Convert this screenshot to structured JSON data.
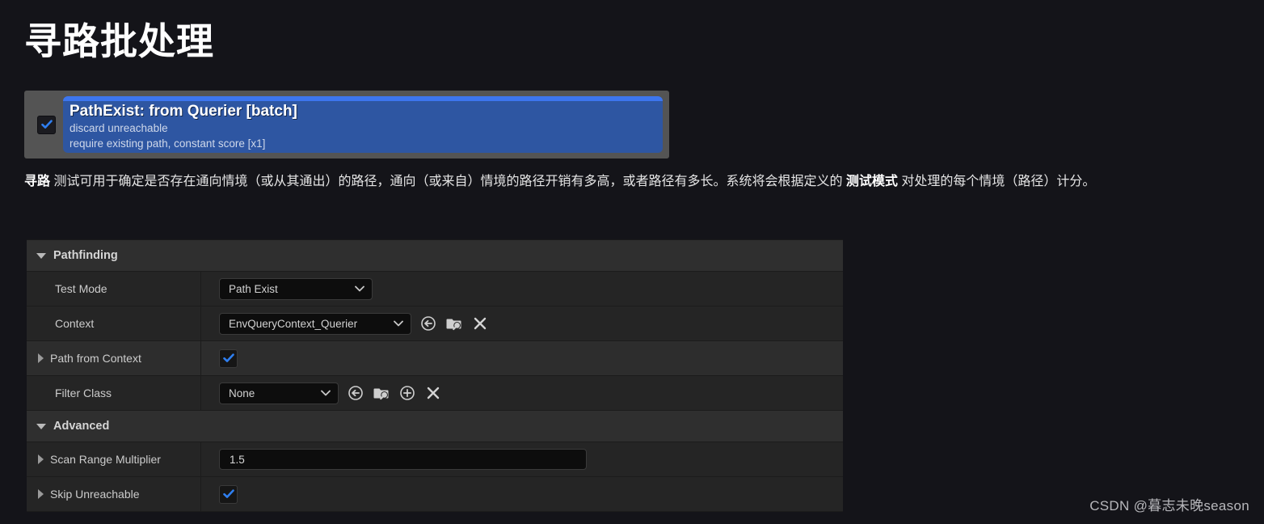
{
  "page": {
    "title": "寻路批处理",
    "background_color": "#141419",
    "watermark": "CSDN @暮志未晚season"
  },
  "node_card": {
    "checkbox_checked": true,
    "title": "PathExist: from Querier [batch]",
    "subtitle_line1": "discard unreachable",
    "subtitle_line2": "require existing path, constant score [x1]",
    "header_accent_color": "#3d76ef",
    "body_color": "#2e56a2",
    "frame_color": "#545454"
  },
  "description": {
    "bold_lead": "寻路",
    "text_1": " 测试可用于确定是否存在通向情境（或从其通出）的路径，通向（或来自）情境的路径开销有多高，或者路径有多长。系统将会根据定义的 ",
    "bold_mid": "测试模式",
    "text_2": " 对处理的每个情境（路径）计分。"
  },
  "details_panel": {
    "sections": [
      {
        "label": "Pathfinding",
        "expanded": true,
        "rows": [
          {
            "name": "Test Mode",
            "has_expander": false,
            "control": "combo",
            "value": "Path Exist",
            "alt_row": false,
            "icons": []
          },
          {
            "name": "Context",
            "has_expander": false,
            "control": "combo",
            "value": "EnvQueryContext_Querier",
            "alt_row": false,
            "icons": [
              "use-selected-asset-icon",
              "browse-asset-icon",
              "clear-asset-icon"
            ]
          },
          {
            "name": "Path from Context",
            "has_expander": true,
            "control": "checkbox",
            "value": true,
            "alt_row": true,
            "icons": []
          },
          {
            "name": "Filter Class",
            "has_expander": false,
            "control": "combo",
            "value": "None",
            "alt_row": false,
            "icons": [
              "use-selected-asset-icon",
              "browse-asset-icon",
              "new-asset-icon",
              "clear-asset-icon"
            ]
          }
        ]
      },
      {
        "label": "Advanced",
        "expanded": true,
        "rows": [
          {
            "name": "Scan Range Multiplier",
            "has_expander": true,
            "control": "number",
            "value": "1.5",
            "alt_row": false,
            "icons": []
          },
          {
            "name": "Skip Unreachable",
            "has_expander": true,
            "control": "checkbox",
            "value": true,
            "alt_row": false,
            "icons": []
          }
        ]
      }
    ]
  }
}
